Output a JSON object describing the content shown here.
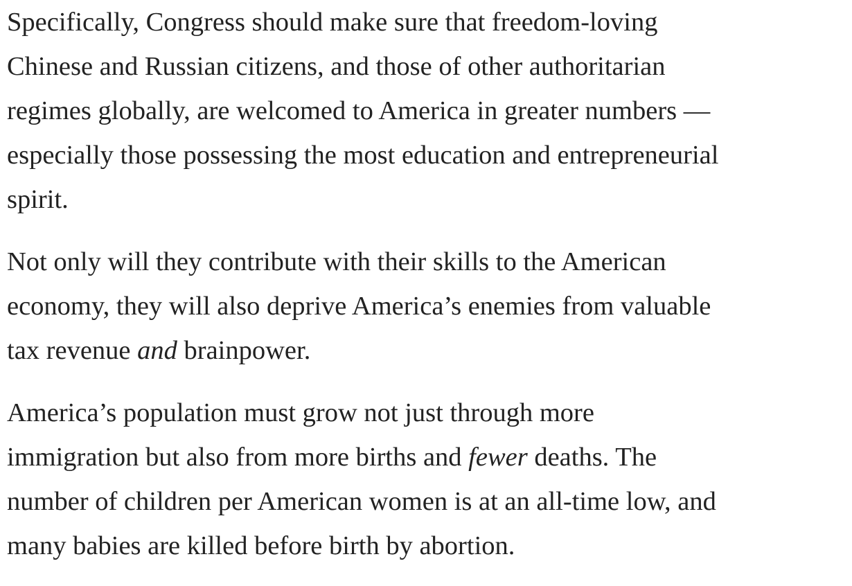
{
  "article": {
    "paragraphs": [
      {
        "text": "Specifically, Congress should make sure that freedom-loving\nChinese and Russian citizens, and those of other authoritarian\nregimes globally, are welcomed to America in greater numbers —\nespecially those possessing the most education and entrepreneurial\nspirit."
      },
      {
        "before": "Not only will they contribute with their skills to the American\neconomy, they will also deprive America’s enemies from valuable\ntax revenue ",
        "emphasis": "and",
        "after": " brainpower."
      },
      {
        "before": "America’s population must grow not just through more\nimmigration but also from more births and ",
        "emphasis": "fewer",
        "after": " deaths. The\nnumber of children per American women is at an all-time low, and\nmany babies are killed before birth by abortion."
      }
    ]
  }
}
